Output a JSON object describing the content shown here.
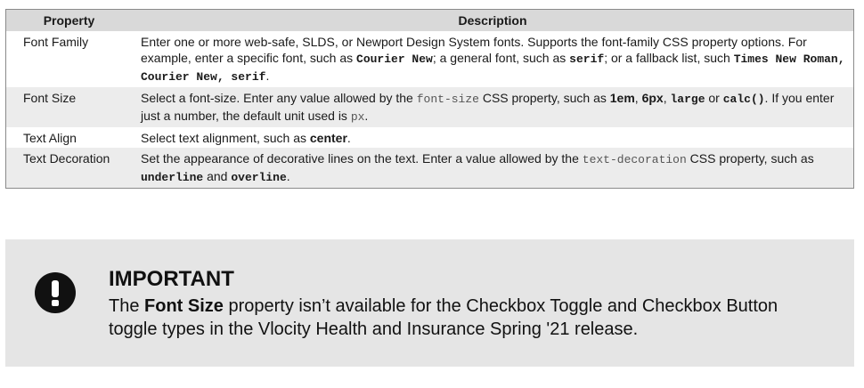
{
  "table": {
    "headers": {
      "property": "Property",
      "description": "Description"
    },
    "rows": [
      {
        "property": "Font Family",
        "desc": {
          "t1": "Enter one or more web-safe, SLDS, or Newport Design System fonts. Supports the font-family CSS property options. For example, enter a specific font, such as ",
          "c1": "Courier New",
          "t2": "; a general font, such as ",
          "c2": "serif",
          "t3": "; or a fallback list, such ",
          "c3": "Times New Roman, Courier New, serif",
          "t4": "."
        }
      },
      {
        "property": "Font Size",
        "desc": {
          "t1": "Select a font-size. Enter any value allowed by the ",
          "m1": "font-size",
          "t2": " CSS property, such as ",
          "b1": "1em",
          "t3": ", ",
          "b2": "6px",
          "t4": ", ",
          "c1": "large",
          "t5": " or ",
          "c2": "calc()",
          "t6": ". If you enter just a number, the default unit used is ",
          "m2": "px",
          "t7": "."
        }
      },
      {
        "property": "Text Align",
        "desc": {
          "t1": "Select text alignment, such as ",
          "b1": "center",
          "t2": "."
        }
      },
      {
        "property": "Text Decoration",
        "desc": {
          "t1": "Set the appearance of decorative lines on the text. Enter a value allowed by the ",
          "m1": "text-decoration",
          "t2": " CSS property, such as ",
          "c1": "underline",
          "t3": " and ",
          "c2": "overline",
          "t4": "."
        }
      }
    ]
  },
  "callout": {
    "icon": "exclamation-circle-icon",
    "title": "IMPORTANT",
    "t1": "The ",
    "b1": "Font Size",
    "t2": " property isn’t available for the Checkbox Toggle and Checkbox Button toggle types in the Vlocity Health and Insurance Spring '21 release."
  },
  "colors": {
    "header_bg": "#d9d9d9",
    "alt_row_bg": "#ececec",
    "callout_bg": "#e5e5e5",
    "icon": "#111111"
  }
}
